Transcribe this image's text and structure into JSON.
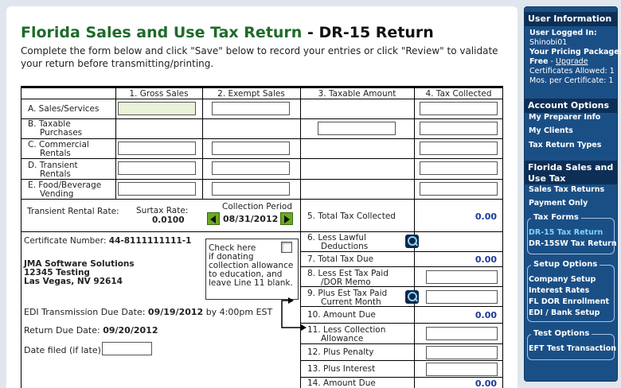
{
  "title": {
    "part1": "Florida Sales and Use Tax Return",
    "separator": " - ",
    "part2": "DR-15 Return"
  },
  "intro": "Complete the form below and click \"Save\" below to record your entries or click \"Review\" to validate your return before transmitting/printing.",
  "columns": [
    "1. Gross Sales",
    "2. Exempt Sales",
    "3. Taxable Amount",
    "4. Tax Collected"
  ],
  "rows": {
    "a": {
      "line1": "A.  Sales/Services",
      "line2": ""
    },
    "b": {
      "line1": "B.  Taxable",
      "line2": "Purchases"
    },
    "c": {
      "line1": "C.  Commercial",
      "line2": "Rentals"
    },
    "d": {
      "line1": "D.  Transient",
      "line2": "Rentals"
    },
    "e": {
      "line1": "E.  Food/Beverage",
      "line2": "Vending"
    }
  },
  "rates": {
    "transient_label": "Transient Rental Rate:",
    "surtax_label": "Surtax Rate:",
    "surtax_value": "0.0100"
  },
  "collection_period": {
    "label": "Collection Period",
    "value": "08/31/2012"
  },
  "summary_lines": [
    {
      "line1": "5.  Total Tax Collected",
      "line2": "",
      "value": "0.00"
    },
    {
      "line1": "6.  Less Lawful",
      "line2": "Deductions",
      "value": ""
    },
    {
      "line1": "7.  Total Tax Due",
      "line2": "",
      "value": "0.00"
    },
    {
      "line1": "8.  Less Est Tax Paid",
      "line2": "/DOR Memo",
      "value": ""
    },
    {
      "line1": "9.  Plus Est Tax Paid",
      "line2": "Current Month",
      "value": ""
    },
    {
      "line1": "10. Amount Due",
      "line2": "",
      "value": "0.00"
    },
    {
      "line1": "11. Less Collection",
      "line2": "Allowance",
      "value": ""
    },
    {
      "line1": "12. Plus Penalty",
      "line2": "",
      "value": ""
    },
    {
      "line1": "13. Plus Interest",
      "line2": "",
      "value": ""
    },
    {
      "line1": "14. Amount Due",
      "line2": "",
      "value": "0.00"
    }
  ],
  "certificate": {
    "label": "Certificate Number:",
    "value": "44-8111111111-1"
  },
  "company": {
    "name": "JMA Software Solutions",
    "address": "12345 Testing",
    "city": "Las Vegas, NV 92614"
  },
  "donate_note": {
    "l1": "Check here",
    "l2": "if donating",
    "l3": "collection allowance",
    "l4": "to education, and",
    "l5": "leave Line 11 blank."
  },
  "edi_due": {
    "label": "EDI Transmission Due Date:",
    "date": "09/19/2012",
    "time": "by 4:00pm EST"
  },
  "return_due": {
    "label": "Return Due Date:",
    "date": "09/20/2012"
  },
  "date_filed": {
    "label": "Date filed (if late):"
  },
  "sidebar": {
    "user_info": {
      "header": "User Information",
      "logged_in_label": "User Logged In:",
      "username": "Shinobi01",
      "package_label": "Your Pricing Package:",
      "package_value": "Free",
      "package_sep": " - ",
      "upgrade": "Upgrade",
      "certs_allowed": "Certificates Allowed: 1",
      "mos_per_cert": "Mos. per Certificate: 1"
    },
    "account_options": {
      "header": "Account Options",
      "items": [
        "My Preparer Info",
        "My Clients",
        "Tax Return Types"
      ]
    },
    "florida": {
      "header_l1": "Florida Sales and",
      "header_l2": "Use Tax",
      "items": [
        "Sales Tax Returns",
        "Payment Only"
      ],
      "tax_forms": {
        "label": "Tax Forms",
        "items": [
          "DR-15 Tax Return",
          "DR-15SW Tax Return"
        ]
      },
      "setup": {
        "label": "Setup Options",
        "items": [
          "Company Setup",
          "Interest Rates",
          "FL DOR Enrollment",
          "EDI / Bank Setup"
        ]
      },
      "test": {
        "label": "Test Options",
        "items": [
          "EFT Test Transaction"
        ]
      }
    }
  },
  "colors": {
    "title_green": "#1d6b2a",
    "value_blue": "#1c3a9a",
    "sidebar_bg": "#1a4f86",
    "sidebar_header": "#0d2f56",
    "active_link": "#7fd3ff",
    "highlight_input": "#eaf3d8"
  }
}
